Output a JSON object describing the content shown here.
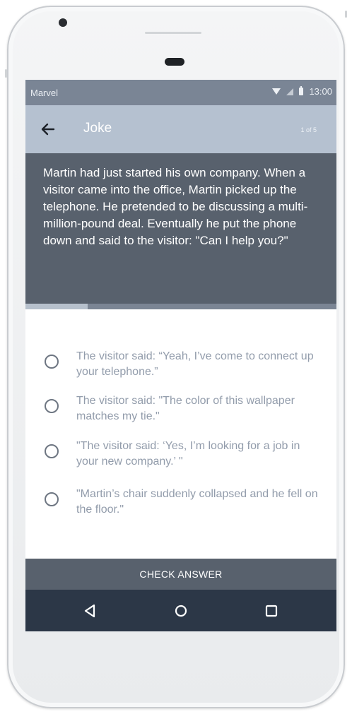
{
  "status_bar": {
    "carrier": "Marvel",
    "time": "13:00",
    "icons": [
      "wifi-icon",
      "signal-icon",
      "battery-icon"
    ]
  },
  "app_bar": {
    "back_icon": "arrow-left-icon",
    "title": "Joke",
    "counter": "1 of 5"
  },
  "question": {
    "text": "Martin had just started his own company. When a visitor came into the office, Martin picked up the telephone. He pretended to be discussing a multi-million-pound deal. Eventually he put the phone down and said to the visitor: \"Can I help you?\""
  },
  "progress": {
    "current": 1,
    "total": 5
  },
  "options": [
    {
      "label": "The visitor said: “Yeah, I’ve come to connect up your telephone.”",
      "selected": false
    },
    {
      "label": "The visitor said: \"The color of this wallpaper matches my tie.\"",
      "selected": false
    },
    {
      "label": "\"The visitor said: ‘Yes, I’m looking for a job in your new company.’ \"",
      "selected": false
    },
    {
      "label": "\"Martin’s chair suddenly collapsed and he fell on the floor.\"",
      "selected": false
    }
  ],
  "check_button": {
    "label": "CHECK ANSWER"
  },
  "nav_bar": {
    "buttons": [
      "back-triangle-icon",
      "home-circle-icon",
      "recents-square-icon"
    ]
  },
  "colors": {
    "status_bar": "#7a8595",
    "app_bar": "#b5c1d0",
    "question_panel": "#58616d",
    "option_text": "#929cab",
    "nav_bar": "#2c3747"
  }
}
